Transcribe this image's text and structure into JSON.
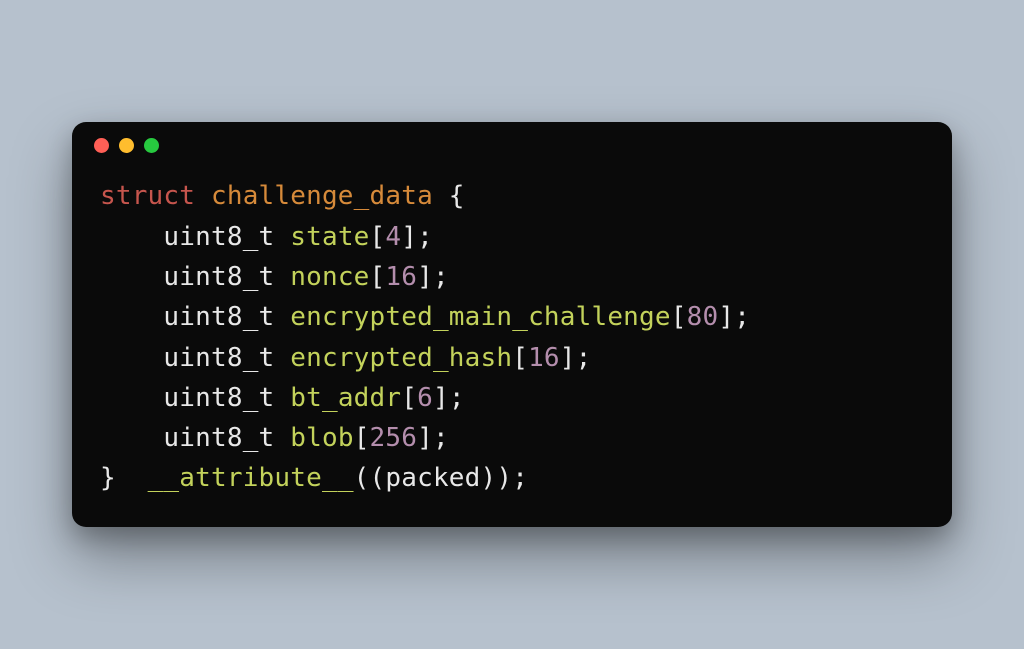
{
  "window": {
    "traffic_lights": {
      "close_color": "#ff5f56",
      "minimize_color": "#ffbd2e",
      "zoom_color": "#27c93f"
    }
  },
  "code": {
    "keyword_struct": "struct",
    "struct_name": "challenge_data",
    "open_brace": "{",
    "close_brace": "}",
    "base_type": "uint8_t",
    "fields": [
      {
        "name": "state",
        "size": "4"
      },
      {
        "name": "nonce",
        "size": "16"
      },
      {
        "name": "encrypted_main_challenge",
        "size": "80"
      },
      {
        "name": "encrypted_hash",
        "size": "16"
      },
      {
        "name": "bt_addr",
        "size": "6"
      },
      {
        "name": "blob",
        "size": "256"
      }
    ],
    "attribute_name": "__attribute__",
    "attribute_args": "((packed))",
    "punct": {
      "lbracket": "[",
      "rbracket": "]",
      "semicolon": ";",
      "space": " "
    }
  }
}
